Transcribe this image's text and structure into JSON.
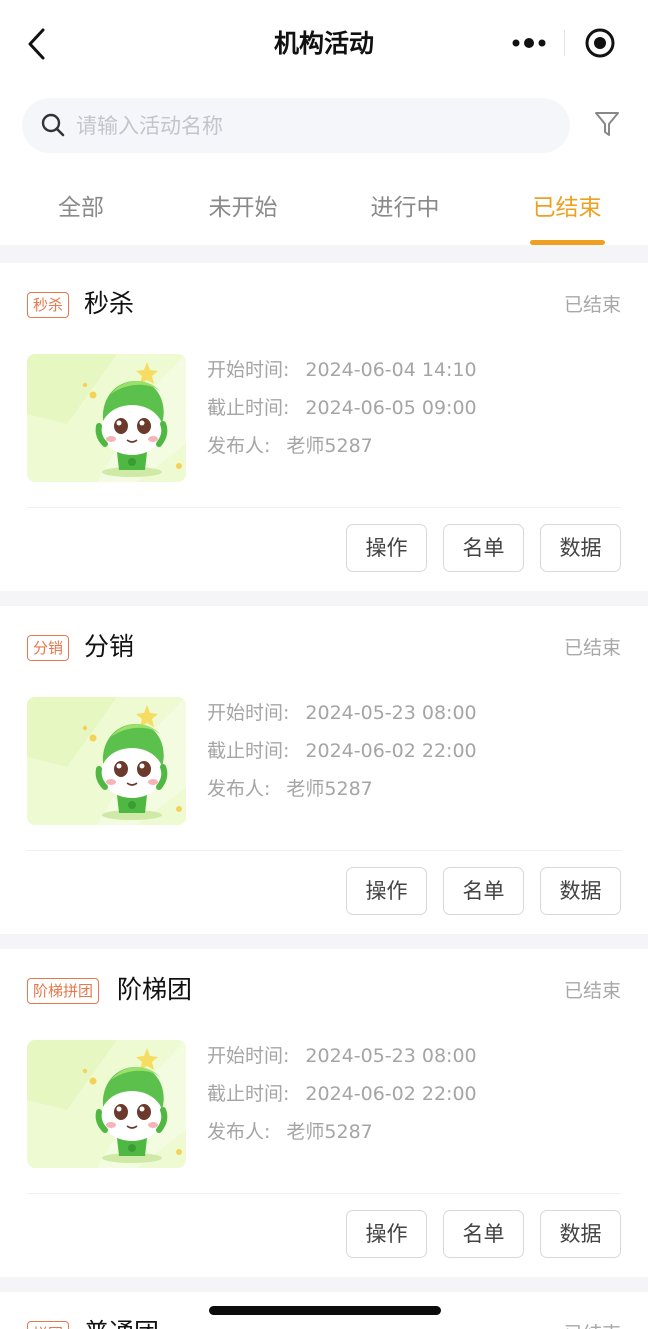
{
  "nav": {
    "title": "机构活动",
    "back_icon": "chevron-left-icon",
    "more_icon": "more-dots-icon",
    "target_icon": "target-icon"
  },
  "search": {
    "placeholder": "请输入活动名称",
    "value": "",
    "filter_icon": "filter-icon"
  },
  "tabs": [
    {
      "label": "全部",
      "active": false
    },
    {
      "label": "未开始",
      "active": false
    },
    {
      "label": "进行中",
      "active": false
    },
    {
      "label": "已结束",
      "active": true
    }
  ],
  "colors": {
    "accent": "#f0a020",
    "badge": "#e8774a",
    "muted_text": "#a5a5a5"
  },
  "labels": {
    "start": "开始时间:",
    "end": "截止时间:",
    "publisher": "发布人:"
  },
  "cards": [
    {
      "badge": "秒杀",
      "title": "秒杀",
      "status": "已结束",
      "start": "2024-06-04 14:10",
      "end": "2024-06-05 09:00",
      "publisher": "老师5287",
      "buttons": {
        "operate": "操作",
        "list": "名单",
        "data": "数据"
      }
    },
    {
      "badge": "分销",
      "title": "分销",
      "status": "已结束",
      "start": "2024-05-23 08:00",
      "end": "2024-06-02 22:00",
      "publisher": "老师5287",
      "buttons": {
        "operate": "操作",
        "list": "名单",
        "data": "数据"
      }
    },
    {
      "badge": "阶梯拼团",
      "title": "阶梯团",
      "status": "已结束",
      "start": "2024-05-23 08:00",
      "end": "2024-06-02 22:00",
      "publisher": "老师5287",
      "buttons": {
        "operate": "操作",
        "list": "名单",
        "data": "数据"
      }
    },
    {
      "badge": "拼团",
      "title": "普通团",
      "status": "已结束"
    }
  ]
}
